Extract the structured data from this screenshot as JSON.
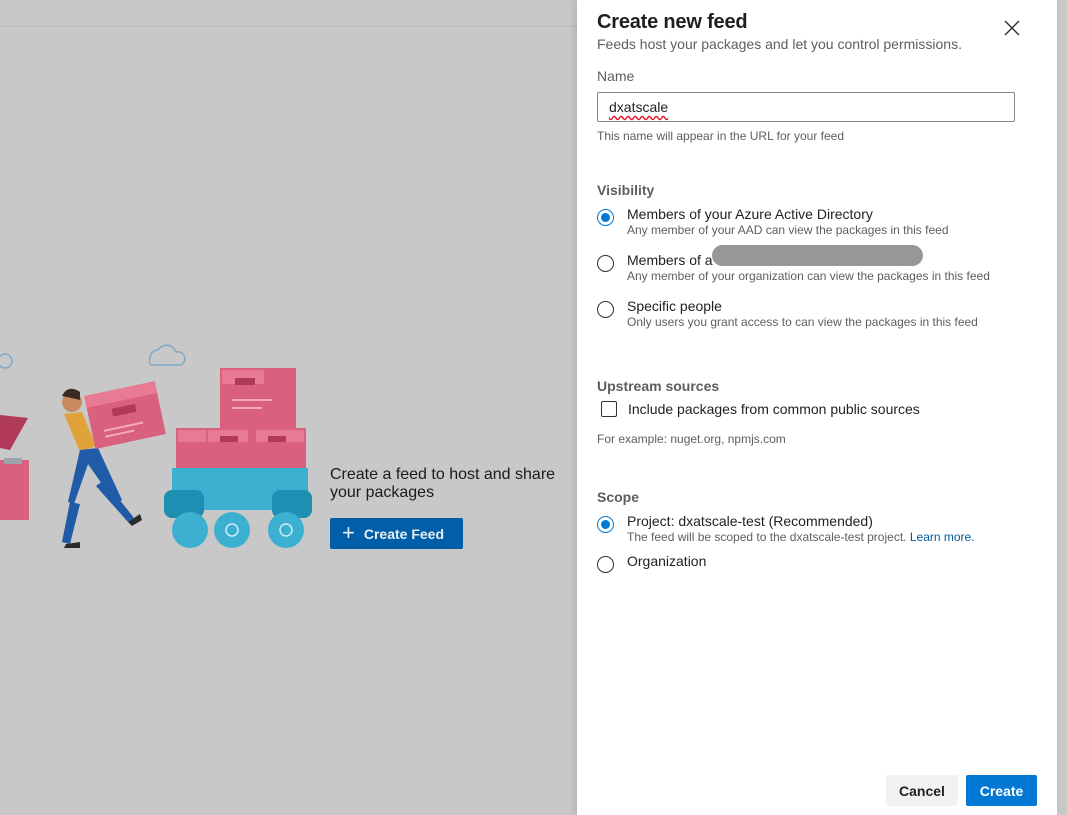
{
  "background": {
    "empty_state_text": "Create a feed to host and share your packages",
    "create_feed_button": "Create Feed"
  },
  "panel": {
    "title": "Create new feed",
    "subtitle": "Feeds host your packages and let you control permissions.",
    "close_icon": "close-icon",
    "name": {
      "label": "Name",
      "value": "dxatscale",
      "hint": "This name will appear in the URL for your feed"
    },
    "visibility": {
      "heading": "Visibility",
      "options": [
        {
          "title": "Members of your Azure Active Directory",
          "description": "Any member of your AAD can view the packages in this feed",
          "checked": true
        },
        {
          "title": "Members of a",
          "description": "Any member of your organization can view the packages in this feed",
          "checked": false
        },
        {
          "title": "Specific people",
          "description": "Only users you grant access to can view the packages in this feed",
          "checked": false
        }
      ]
    },
    "upstream": {
      "heading": "Upstream sources",
      "checkbox_label": "Include packages from common public sources",
      "checked": false,
      "example": "For example: nuget.org, npmjs.com"
    },
    "scope": {
      "heading": "Scope",
      "options": [
        {
          "title": "Project: dxatscale-test (Recommended)",
          "description": "The feed will be scoped to the dxatscale-test project.",
          "link": "Learn more.",
          "checked": true
        },
        {
          "title": "Organization",
          "checked": false
        }
      ]
    },
    "buttons": {
      "cancel": "Cancel",
      "create": "Create"
    }
  },
  "colors": {
    "accent": "#0078d4",
    "primary_button": "#0078d4",
    "background_button": "#005fa8"
  }
}
